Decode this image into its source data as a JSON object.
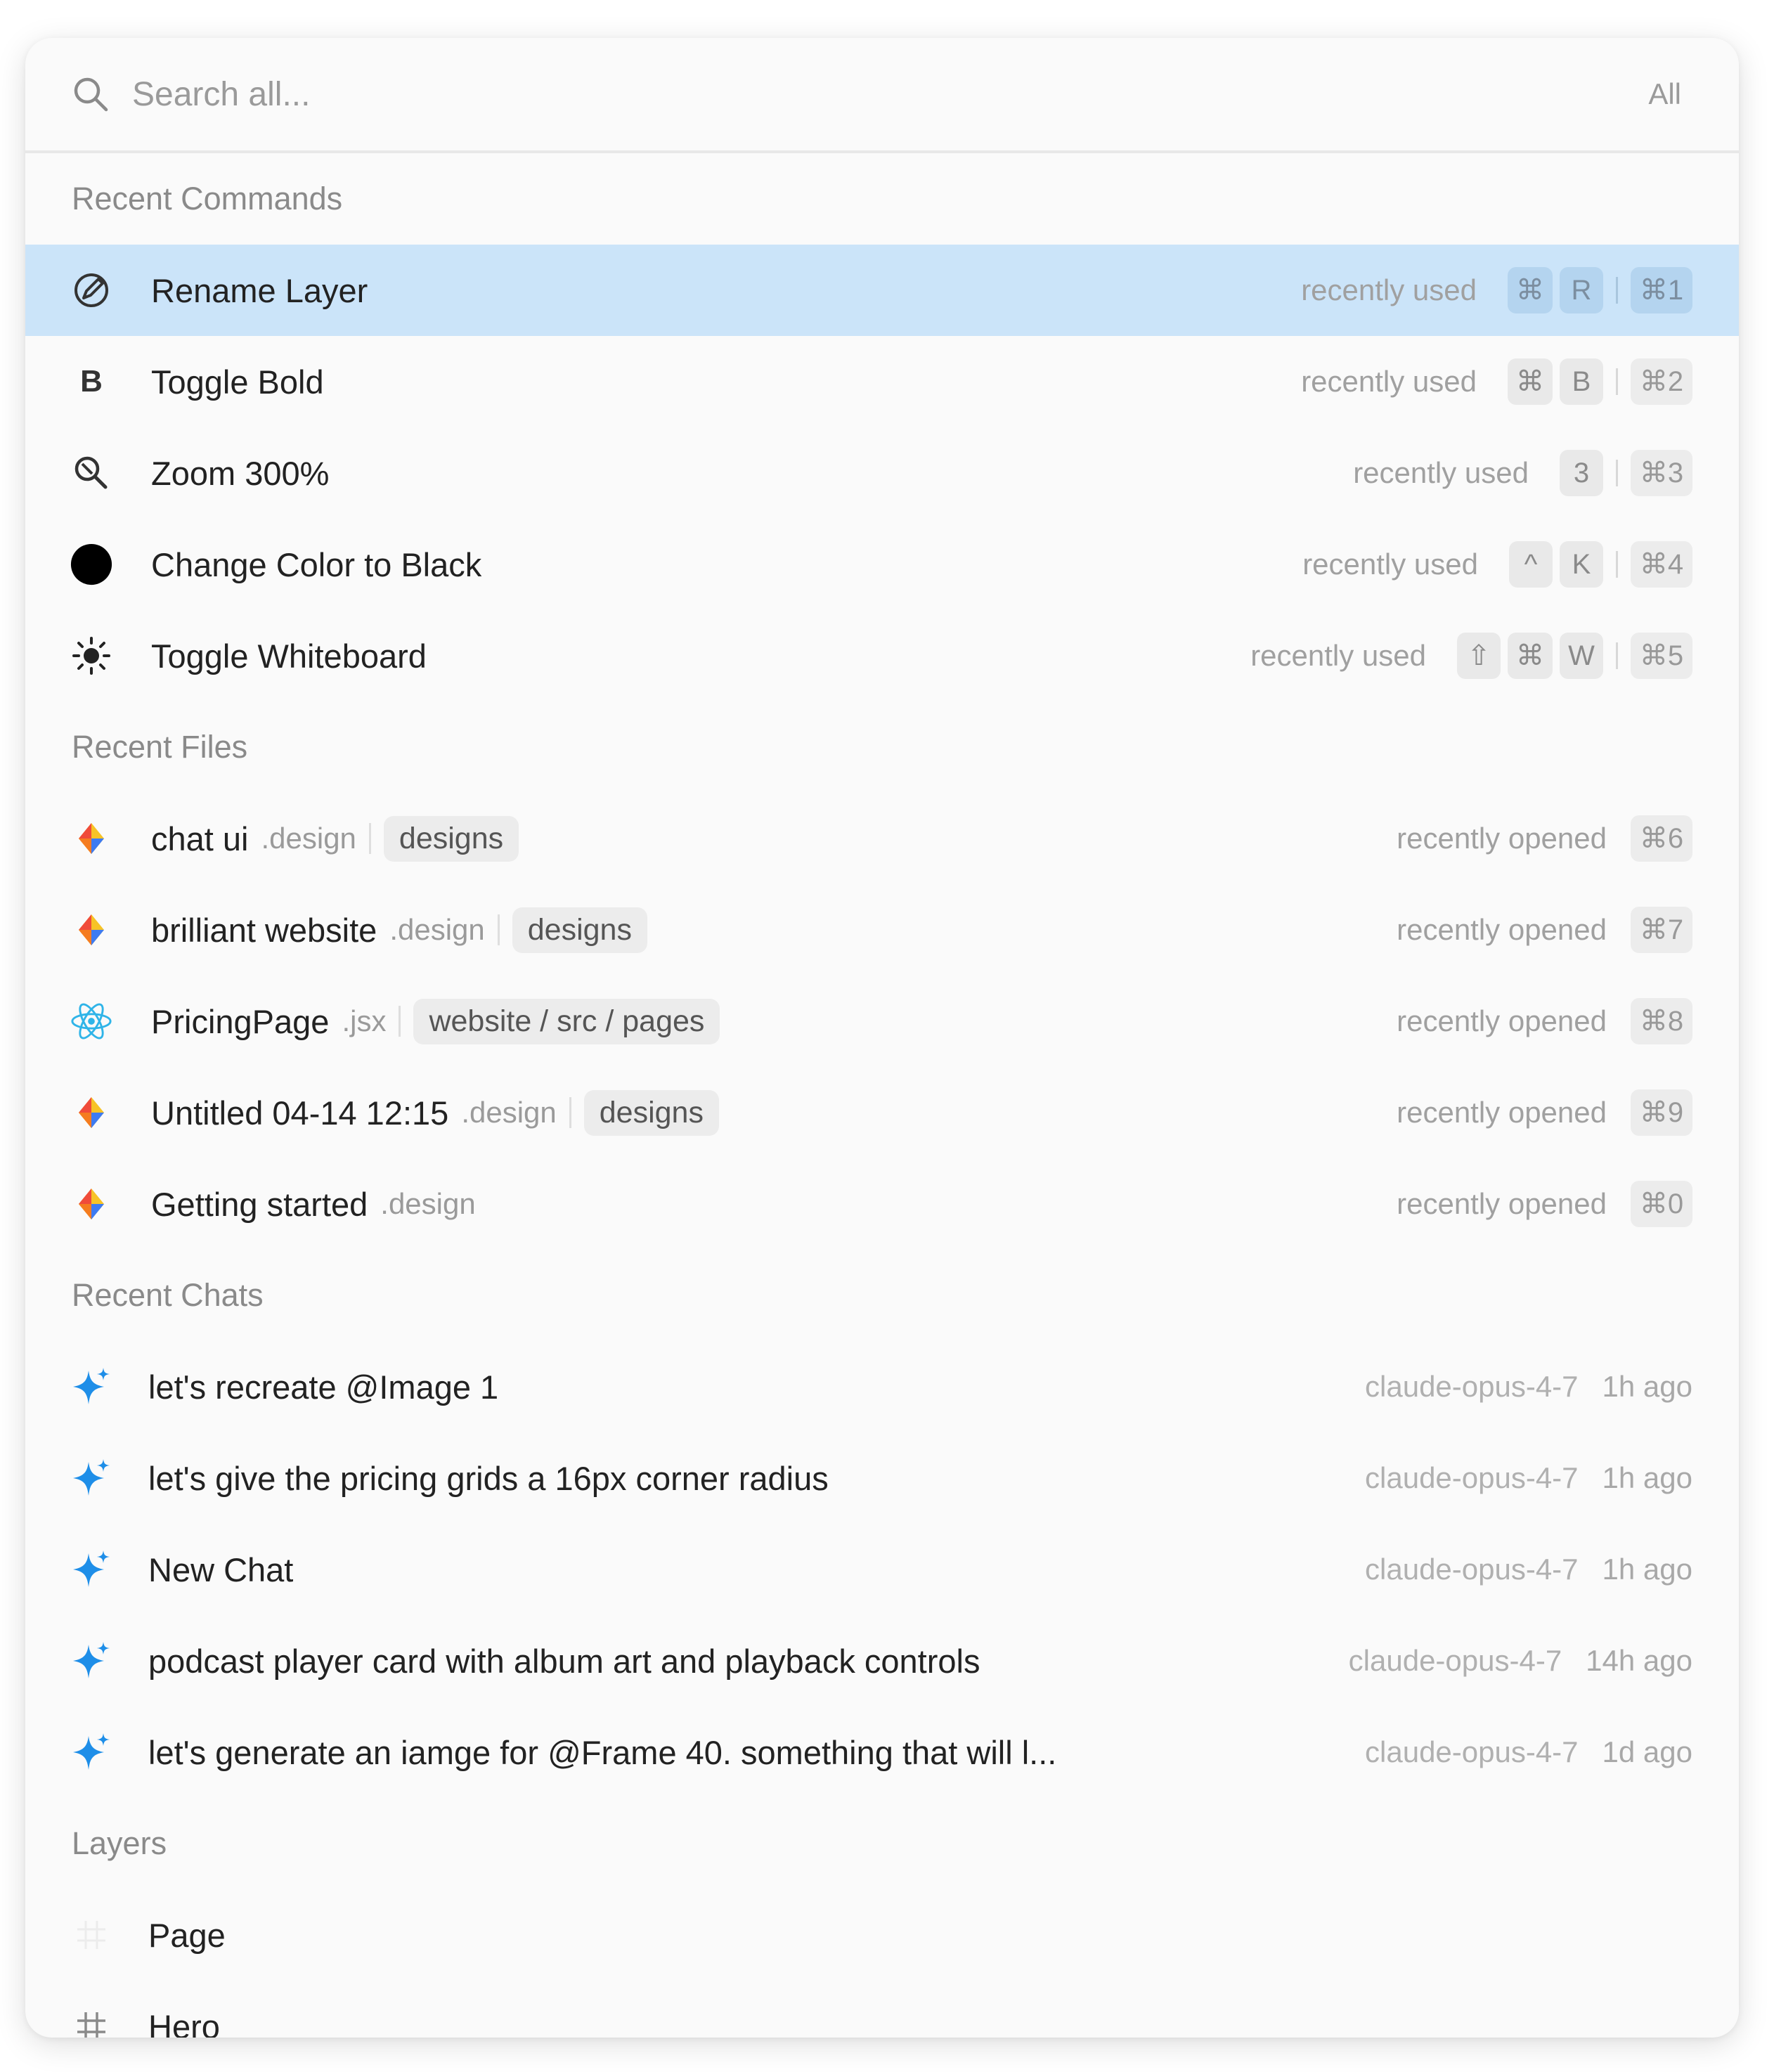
{
  "search": {
    "placeholder": "Search all...",
    "filter_label": "All"
  },
  "sections": {
    "commands": "Recent Commands",
    "files": "Recent Files",
    "chats": "Recent Chats",
    "layers": "Layers"
  },
  "commands": [
    {
      "label": "Rename Layer",
      "icon": "rename-icon",
      "meta": "recently used",
      "keys": [
        "⌘",
        "R"
      ],
      "shortcut": "⌘1"
    },
    {
      "label": "Toggle Bold",
      "icon": "bold-icon",
      "meta": "recently used",
      "keys": [
        "⌘",
        "B"
      ],
      "shortcut": "⌘2"
    },
    {
      "label": "Zoom 300%",
      "icon": "zoom-icon",
      "meta": "recently used",
      "keys": [
        "3"
      ],
      "shortcut": "⌘3"
    },
    {
      "label": "Change Color to Black",
      "icon": "color-swatch-icon",
      "meta": "recently used",
      "keys": [
        "^",
        "K"
      ],
      "shortcut": "⌘4"
    },
    {
      "label": "Toggle Whiteboard",
      "icon": "sun-icon",
      "meta": "recently used",
      "keys": [
        "⇧",
        "⌘",
        "W"
      ],
      "shortcut": "⌘5"
    }
  ],
  "files": [
    {
      "name": "chat ui",
      "ext": ".design",
      "tag": "designs",
      "meta": "recently opened",
      "shortcut": "⌘6",
      "icon": "design-file-icon"
    },
    {
      "name": "brilliant website",
      "ext": ".design",
      "tag": "designs",
      "meta": "recently opened",
      "shortcut": "⌘7",
      "icon": "design-file-icon"
    },
    {
      "name": "PricingPage",
      "ext": ".jsx",
      "tag": "website / src / pages",
      "meta": "recently opened",
      "shortcut": "⌘8",
      "icon": "react-icon"
    },
    {
      "name": "Untitled 04-14 12:15",
      "ext": ".design",
      "tag": "designs",
      "meta": "recently opened",
      "shortcut": "⌘9",
      "icon": "design-file-icon"
    },
    {
      "name": "Getting started",
      "ext": ".design",
      "tag": "",
      "meta": "recently opened",
      "shortcut": "⌘0",
      "icon": "design-file-icon"
    }
  ],
  "chats": [
    {
      "title": "let's recreate @Image 1",
      "model": "claude-opus-4-7",
      "time": "1h ago"
    },
    {
      "title": "let's give the pricing grids a 16px corner radius",
      "model": "claude-opus-4-7",
      "time": "1h ago"
    },
    {
      "title": "New Chat",
      "model": "claude-opus-4-7",
      "time": "1h ago"
    },
    {
      "title": "podcast player card with album art and playback controls",
      "model": "claude-opus-4-7",
      "time": "14h ago"
    },
    {
      "title": "let's generate an iamge for @Frame 40. something that will l...",
      "model": "claude-opus-4-7",
      "time": "1d ago"
    }
  ],
  "layers": [
    {
      "label": "Page",
      "icon": "page-icon"
    },
    {
      "label": "Hero",
      "icon": "frame-hash-icon"
    }
  ],
  "colors": {
    "selected_row": "#cbe4f9",
    "sparkle": "#1e8ee8",
    "react": "#2fb4e8"
  }
}
